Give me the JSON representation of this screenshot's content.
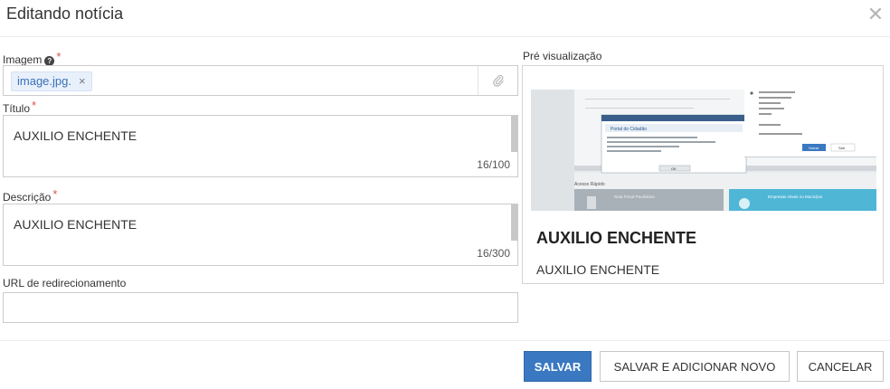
{
  "modal": {
    "title": "Editando notícia",
    "close_glyph": "✕"
  },
  "form": {
    "image": {
      "label": "Imagem",
      "required_mark": "*",
      "help_glyph": "?",
      "tag_value": "image.jpg.",
      "tag_remove_glyph": "×",
      "attach_icon": "paperclip-icon"
    },
    "title": {
      "label": "Título",
      "required_mark": "*",
      "value": "AUXILIO ENCHENTE",
      "counter": "16/100"
    },
    "description": {
      "label": "Descrição",
      "required_mark": "*",
      "value": "AUXILIO ENCHENTE",
      "counter": "16/300"
    },
    "redirect_url": {
      "label": "URL de redirecionamento",
      "value": ""
    }
  },
  "preview": {
    "label": "Pré visualização",
    "title": "AUXILIO ENCHENTE",
    "description": "AUXILIO ENCHENTE",
    "thumbnail": {
      "dialog_title": "Portal do Cidadão",
      "ok_label": "OK",
      "quick_access_label": "Acesso Rápido",
      "tile_1": "Nota Fiscal Paulistana",
      "tile_2": "Empresas Ativas no Município",
      "save_label": "Salvar",
      "cancel_label": "Sair"
    }
  },
  "actions": {
    "save": "SALVAR",
    "save_add_new": "SALVAR E ADICIONAR NOVO",
    "cancel": "CANCELAR"
  },
  "colors": {
    "primary": "#3a78c1",
    "required": "#d9534f",
    "tag_bg": "#e8f0fb",
    "tag_text": "#3b6fb6"
  }
}
